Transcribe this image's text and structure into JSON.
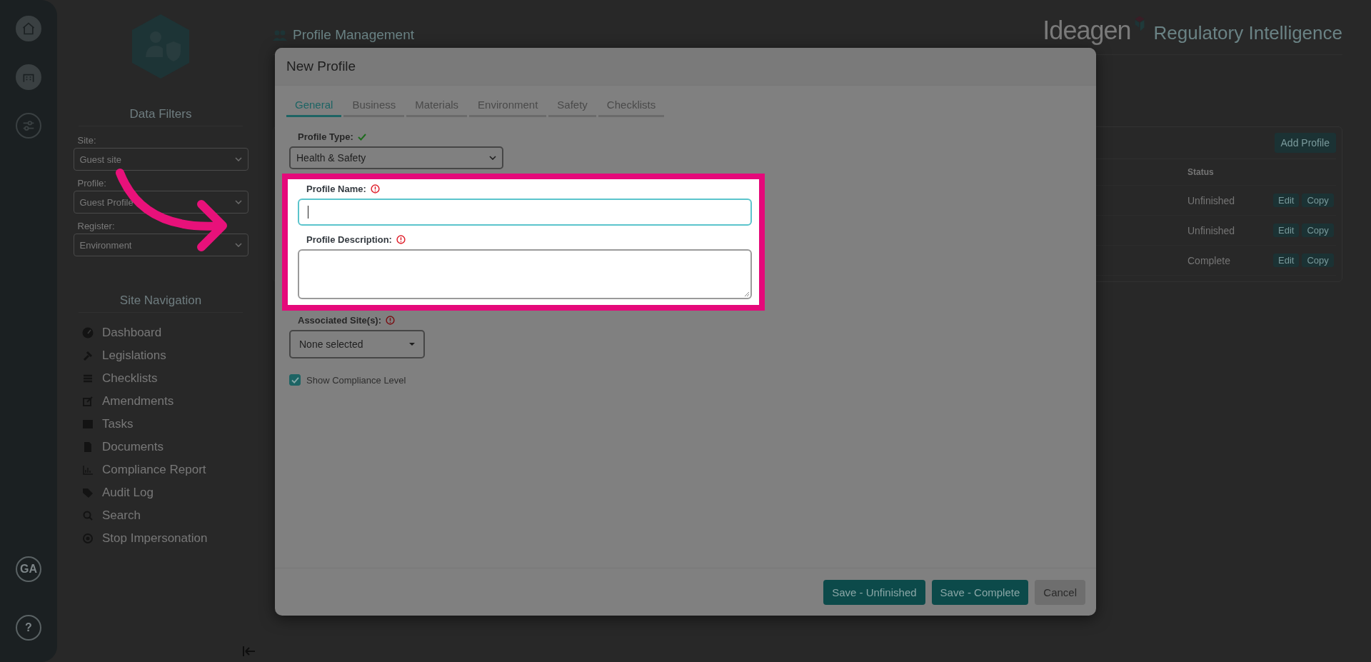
{
  "rail": {
    "avatar": "GA",
    "help": "?"
  },
  "sidebar": {
    "filters_title": "Data Filters",
    "filters": [
      {
        "label": "Site:",
        "value": "Guest site"
      },
      {
        "label": "Profile:",
        "value": "Guest Profile"
      },
      {
        "label": "Register:",
        "value": "Environment"
      }
    ],
    "nav_title": "Site Navigation",
    "nav": [
      {
        "label": "Dashboard"
      },
      {
        "label": "Legislations"
      },
      {
        "label": "Checklists"
      },
      {
        "label": "Amendments"
      },
      {
        "label": "Tasks"
      },
      {
        "label": "Documents"
      },
      {
        "label": "Compliance Report"
      },
      {
        "label": "Audit Log"
      },
      {
        "label": "Search"
      },
      {
        "label": "Stop Impersonation"
      }
    ]
  },
  "page": {
    "title": "Profile Management"
  },
  "brand": {
    "name": "Ideagen",
    "product": "Regulatory Intelligence"
  },
  "profiles_table": {
    "add_button": "Add Profile",
    "columns": [
      "Status"
    ],
    "rows": [
      {
        "status": "Unfinished",
        "actions": [
          "Edit",
          "Copy"
        ]
      },
      {
        "status": "Unfinished",
        "actions": [
          "Edit",
          "Copy"
        ]
      },
      {
        "status": "Complete",
        "actions": [
          "Edit",
          "Copy"
        ]
      }
    ]
  },
  "modal": {
    "title": "New Profile",
    "tabs": [
      {
        "label": "General",
        "selected": true
      },
      {
        "label": "Business",
        "selected": false
      },
      {
        "label": "Materials",
        "selected": false
      },
      {
        "label": "Environment",
        "selected": false
      },
      {
        "label": "Safety",
        "selected": false
      },
      {
        "label": "Checklists",
        "selected": false
      }
    ],
    "fields": [
      {
        "kind": "select",
        "label": "Profile Type:",
        "valid": true,
        "value": "Health & Safety",
        "highlighted": false
      },
      {
        "kind": "text",
        "label": "Profile Name:",
        "valid": false,
        "focused": true,
        "highlighted": true
      },
      {
        "kind": "textarea",
        "label": "Profile Description:",
        "valid": false,
        "focused": false,
        "highlighted": true
      },
      {
        "kind": "multiselect",
        "label": "Associated Site(s):",
        "valid": false,
        "value": "None selected",
        "highlighted": false
      }
    ],
    "show_compliance": {
      "label": "Show Compliance Level",
      "checked": true
    },
    "buttons": [
      {
        "label": "Save - Unfinished",
        "kind": "primary"
      },
      {
        "label": "Save - Complete",
        "kind": "primary"
      },
      {
        "label": "Cancel",
        "kind": "secondary"
      }
    ]
  }
}
